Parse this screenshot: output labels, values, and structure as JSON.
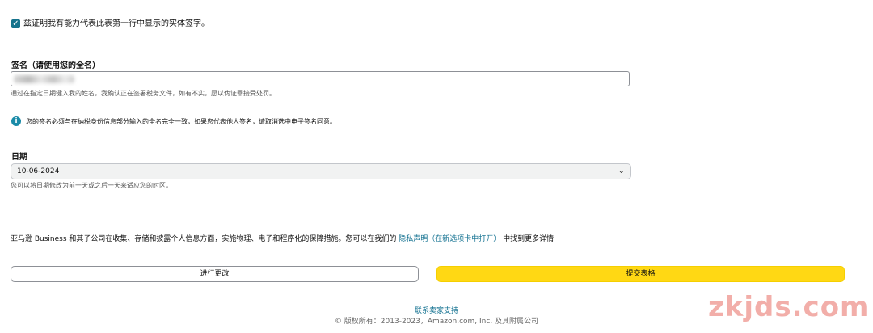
{
  "certification": {
    "checked": true,
    "text": "兹证明我有能力代表此表第一行中显示的实体签字。"
  },
  "signature": {
    "label": "签名（请使用您的全名）",
    "hint": "通过在指定日期键入我的姓名，我确认正在签署税务文件，如有不实，愿以伪证罪接受处罚。"
  },
  "info": {
    "text": "您的签名必须与在纳税身份信息部分输入的全名完全一致，如果您代表他人签名，请取消选中电子签名同意。"
  },
  "date": {
    "label": "日期",
    "selected": "10-06-2024",
    "hint": "您可以将日期修改为前一天或之后一天来适应您的时区。"
  },
  "privacy": {
    "text_before": "亚马逊 Business 和其子公司在收集、存储和披露个人信息方面，实施物理、电子和程序化的保障措施。您可以在我们的 ",
    "link": "隐私声明",
    "link_note": "（在新选项卡中打开）",
    "text_after": " 中找到更多详情"
  },
  "buttons": {
    "edit": "进行更改",
    "submit": "提交表格"
  },
  "footer": {
    "support_link": "联系卖家支持",
    "copyright": "© 版权所有：2013-2023，Amazon.com, Inc. 及其附属公司"
  },
  "watermark": "zkjds.com",
  "colors": {
    "accent": "#16738c",
    "submit_button": "#ffd814",
    "link": "#0f6f8f"
  }
}
